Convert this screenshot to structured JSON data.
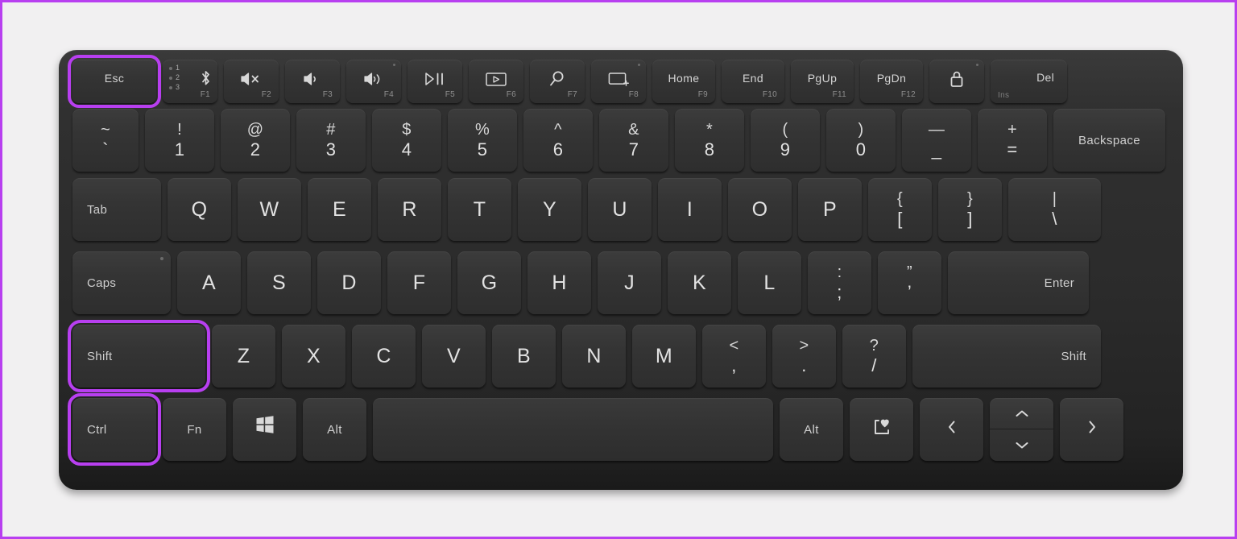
{
  "theme": {
    "highlight_color": "#b83ff0",
    "page_background": "#f1f0f1",
    "keyboard_body": "#2e2e2e",
    "key_face": "#343434",
    "key_text": "#d9d9d9"
  },
  "keyboard": {
    "name": "compact-wireless-keyboard",
    "highlighted_keys": [
      "Esc",
      "Shift",
      "Ctrl"
    ],
    "rows": [
      {
        "id": "function-row",
        "keys": [
          {
            "name": "esc",
            "label": "Esc",
            "type": "word",
            "highlight": true
          },
          {
            "name": "bluetooth-pair",
            "label": "",
            "type": "bluetooth",
            "fn": "F1",
            "channels": [
              "1",
              "2",
              "3"
            ],
            "icon": "bluetooth-icon"
          },
          {
            "name": "volume-mute",
            "label": "",
            "type": "icon",
            "fn": "F2",
            "icon": "volume-mute-icon"
          },
          {
            "name": "volume-down",
            "label": "",
            "type": "icon",
            "fn": "F3",
            "icon": "volume-down-icon"
          },
          {
            "name": "volume-up",
            "label": "",
            "type": "icon",
            "fn": "F4",
            "icon": "volume-up-icon",
            "led": true
          },
          {
            "name": "play-pause",
            "label": "",
            "type": "icon",
            "fn": "F5",
            "icon": "play-pause-icon"
          },
          {
            "name": "screen-capture",
            "label": "",
            "type": "icon",
            "fn": "F6",
            "icon": "screen-record-icon"
          },
          {
            "name": "search",
            "label": "",
            "type": "icon",
            "fn": "F7",
            "icon": "search-icon"
          },
          {
            "name": "project-screen",
            "label": "",
            "type": "icon",
            "fn": "F8",
            "icon": "project-screen-icon",
            "led": true
          },
          {
            "name": "home",
            "label": "Home",
            "type": "word",
            "fn": "F9"
          },
          {
            "name": "end",
            "label": "End",
            "type": "word",
            "fn": "F10"
          },
          {
            "name": "page-up",
            "label": "PgUp",
            "type": "word",
            "fn": "F11"
          },
          {
            "name": "page-down",
            "label": "PgDn",
            "type": "word",
            "fn": "F12"
          },
          {
            "name": "lock",
            "label": "",
            "type": "icon",
            "icon": "lock-icon",
            "led": true
          },
          {
            "name": "delete",
            "label": "Del",
            "sub": "Ins",
            "type": "del"
          }
        ]
      },
      {
        "id": "number-row",
        "keys": [
          {
            "name": "backtick",
            "upper": "~",
            "lower": "`",
            "type": "dual"
          },
          {
            "name": "digit-1",
            "upper": "!",
            "lower": "1",
            "type": "dual"
          },
          {
            "name": "digit-2",
            "upper": "@",
            "lower": "2",
            "type": "dual"
          },
          {
            "name": "digit-3",
            "upper": "#",
            "lower": "3",
            "type": "dual"
          },
          {
            "name": "digit-4",
            "upper": "$",
            "lower": "4",
            "type": "dual"
          },
          {
            "name": "digit-5",
            "upper": "%",
            "lower": "5",
            "type": "dual"
          },
          {
            "name": "digit-6",
            "upper": "^",
            "lower": "6",
            "type": "dual"
          },
          {
            "name": "digit-7",
            "upper": "&",
            "lower": "7",
            "type": "dual"
          },
          {
            "name": "digit-8",
            "upper": "*",
            "lower": "8",
            "type": "dual"
          },
          {
            "name": "digit-9",
            "upper": "(",
            "lower": "9",
            "type": "dual"
          },
          {
            "name": "digit-0",
            "upper": ")",
            "lower": "0",
            "type": "dual"
          },
          {
            "name": "minus",
            "upper": "—",
            "lower": "_",
            "type": "dual"
          },
          {
            "name": "equals",
            "upper": "+",
            "lower": "=",
            "type": "dual"
          },
          {
            "name": "backspace",
            "label": "Backspace",
            "type": "word"
          }
        ]
      },
      {
        "id": "top-letter-row",
        "keys": [
          {
            "name": "tab",
            "label": "Tab",
            "type": "word-left"
          },
          {
            "name": "key-q",
            "label": "Q",
            "type": "alpha"
          },
          {
            "name": "key-w",
            "label": "W",
            "type": "alpha"
          },
          {
            "name": "key-e",
            "label": "E",
            "type": "alpha"
          },
          {
            "name": "key-r",
            "label": "R",
            "type": "alpha"
          },
          {
            "name": "key-t",
            "label": "T",
            "type": "alpha"
          },
          {
            "name": "key-y",
            "label": "Y",
            "type": "alpha"
          },
          {
            "name": "key-u",
            "label": "U",
            "type": "alpha"
          },
          {
            "name": "key-i",
            "label": "I",
            "type": "alpha"
          },
          {
            "name": "key-o",
            "label": "O",
            "type": "alpha"
          },
          {
            "name": "key-p",
            "label": "P",
            "type": "alpha"
          },
          {
            "name": "bracket-left",
            "upper": "{",
            "lower": "[",
            "type": "dual"
          },
          {
            "name": "bracket-right",
            "upper": "}",
            "lower": "]",
            "type": "dual"
          },
          {
            "name": "backslash",
            "upper": "|",
            "lower": "\\",
            "type": "dual"
          }
        ]
      },
      {
        "id": "home-row",
        "keys": [
          {
            "name": "caps-lock",
            "label": "Caps",
            "type": "word-left",
            "led": true
          },
          {
            "name": "key-a",
            "label": "A",
            "type": "alpha"
          },
          {
            "name": "key-s",
            "label": "S",
            "type": "alpha"
          },
          {
            "name": "key-d",
            "label": "D",
            "type": "alpha"
          },
          {
            "name": "key-f",
            "label": "F",
            "type": "alpha"
          },
          {
            "name": "key-g",
            "label": "G",
            "type": "alpha"
          },
          {
            "name": "key-h",
            "label": "H",
            "type": "alpha"
          },
          {
            "name": "key-j",
            "label": "J",
            "type": "alpha"
          },
          {
            "name": "key-k",
            "label": "K",
            "type": "alpha"
          },
          {
            "name": "key-l",
            "label": "L",
            "type": "alpha"
          },
          {
            "name": "semicolon",
            "upper": ":",
            "lower": ";",
            "type": "dual"
          },
          {
            "name": "quote",
            "upper": "”",
            "lower": "’",
            "type": "dual"
          },
          {
            "name": "enter",
            "label": "Enter",
            "type": "word-right"
          }
        ]
      },
      {
        "id": "bottom-letter-row",
        "keys": [
          {
            "name": "shift-left",
            "label": "Shift",
            "type": "word-left",
            "highlight": true
          },
          {
            "name": "key-z",
            "label": "Z",
            "type": "alpha"
          },
          {
            "name": "key-x",
            "label": "X",
            "type": "alpha"
          },
          {
            "name": "key-c",
            "label": "C",
            "type": "alpha"
          },
          {
            "name": "key-v",
            "label": "V",
            "type": "alpha"
          },
          {
            "name": "key-b",
            "label": "B",
            "type": "alpha"
          },
          {
            "name": "key-n",
            "label": "N",
            "type": "alpha"
          },
          {
            "name": "key-m",
            "label": "M",
            "type": "alpha"
          },
          {
            "name": "comma",
            "upper": "<",
            "lower": ",",
            "type": "dual"
          },
          {
            "name": "period",
            "upper": ">",
            "lower": ".",
            "type": "dual"
          },
          {
            "name": "slash",
            "upper": "?",
            "lower": "/",
            "type": "dual"
          },
          {
            "name": "shift-right",
            "label": "Shift",
            "type": "word-right"
          }
        ]
      },
      {
        "id": "modifier-row",
        "keys": [
          {
            "name": "ctrl-left",
            "label": "Ctrl",
            "type": "word-left",
            "highlight": true
          },
          {
            "name": "fn",
            "label": "Fn",
            "type": "word"
          },
          {
            "name": "windows",
            "label": "",
            "type": "icon",
            "icon": "windows-logo-icon"
          },
          {
            "name": "alt-left",
            "label": "Alt",
            "type": "word"
          },
          {
            "name": "space",
            "label": "",
            "type": "space"
          },
          {
            "name": "alt-right",
            "label": "Alt",
            "type": "word"
          },
          {
            "name": "emoji",
            "label": "",
            "type": "icon",
            "icon": "emoji-heart-icon"
          },
          {
            "name": "arrow-left",
            "label": "",
            "type": "icon",
            "icon": "chevron-left-icon"
          },
          {
            "name": "arrow-up-down",
            "label": "",
            "type": "updown",
            "icon": "chevron-up-icon",
            "icon2": "chevron-down-icon"
          },
          {
            "name": "arrow-right",
            "label": "",
            "type": "icon",
            "icon": "chevron-right-icon"
          }
        ]
      }
    ]
  }
}
